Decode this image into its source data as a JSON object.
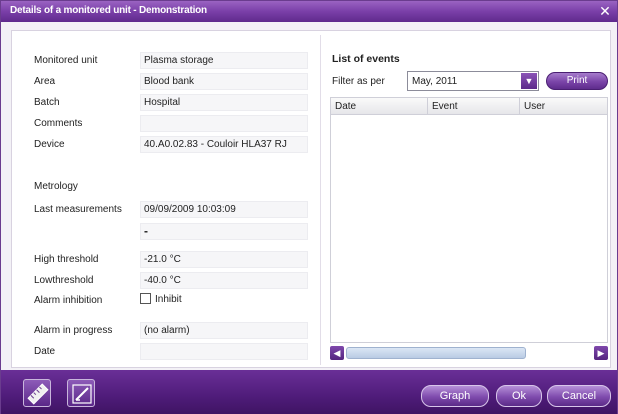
{
  "window": {
    "title": "Details of a monitored unit - Demonstration",
    "close_glyph": "✕"
  },
  "details": {
    "monitored_unit": {
      "label": "Monitored unit",
      "value": "Plasma storage"
    },
    "area": {
      "label": "Area",
      "value": "Blood bank"
    },
    "batch": {
      "label": "Batch",
      "value": "Hospital"
    },
    "comments": {
      "label": "Comments",
      "value": ""
    },
    "device": {
      "label": "Device",
      "value": "40.A0.02.83 - Couloir HLA37 RJ"
    },
    "metrology": {
      "label": "Metrology"
    },
    "last_measurements": {
      "label": "Last measurements",
      "value": "09/09/2009 10:03:09",
      "value2": "-"
    },
    "high_threshold": {
      "label": "High threshold",
      "value": "-21.0 °C"
    },
    "low_threshold": {
      "label": "Lowthreshold",
      "value": "-40.0 °C"
    },
    "alarm_inhibition": {
      "label": "Alarm inhibition",
      "checkbox_label": "Inhibit",
      "checked": false
    },
    "alarm_in_progress": {
      "label": "Alarm in progress",
      "value": "(no alarm)"
    },
    "date": {
      "label": "Date",
      "value": ""
    }
  },
  "events": {
    "title": "List of events",
    "filter_label": "Filter as per",
    "filter_value": "May, 2011",
    "print_label": "Print",
    "columns": [
      "Date",
      "Event",
      "User"
    ],
    "rows": []
  },
  "footer": {
    "graph_label": "Graph",
    "ok_label": "Ok",
    "cancel_label": "Cancel"
  },
  "icons": {
    "close": "close-icon",
    "dropdown": "chevron-down-icon",
    "scroll_left": "chevron-left-icon",
    "scroll_right": "chevron-right-icon",
    "tool1": "ruler-icon",
    "tool2": "edit-icon"
  },
  "colors": {
    "accent": "#6a2f97",
    "title_bar": "#7a3fa8"
  }
}
